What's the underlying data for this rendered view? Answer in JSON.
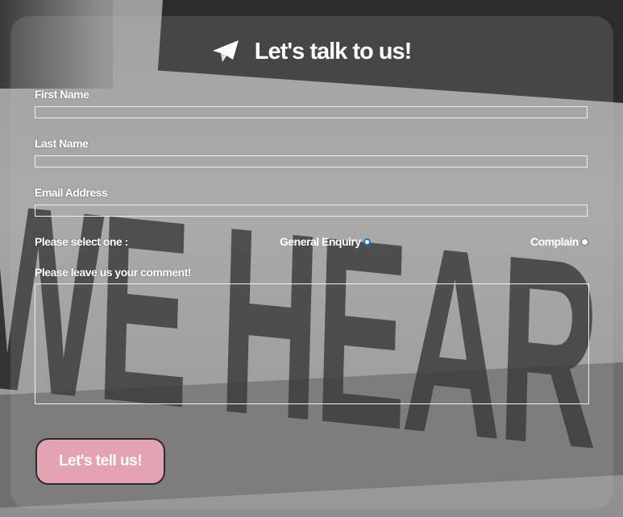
{
  "form": {
    "title": "Let's talk to us!",
    "title_icon": "paper-plane-icon",
    "first_name_label": "First Name",
    "first_name_value": "",
    "last_name_label": "Last Name",
    "last_name_value": "",
    "email_label": "Email Address",
    "email_value": "",
    "select_label": "Please select one :",
    "options": [
      "General Enquiry",
      "Complain"
    ],
    "selected_option": "General Enquiry",
    "comment_label": "Please leave us your comment!",
    "comment_value": "",
    "submit_label": "Let's tell us!"
  },
  "background": {
    "photo_text": "WE HEAR YOU"
  },
  "colors": {
    "submit_bg": "#e4a3b2",
    "radio_selected": "#1a6ed8",
    "text": "#ffffff"
  }
}
